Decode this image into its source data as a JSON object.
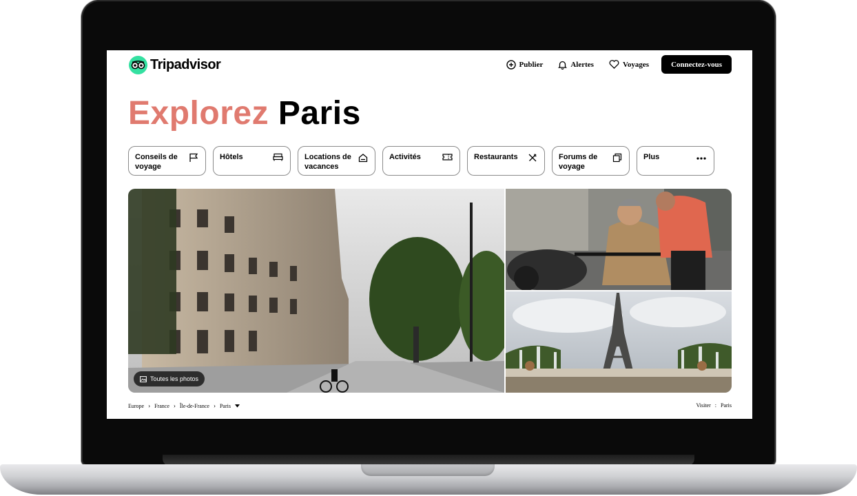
{
  "brand": {
    "name": "Tripadvisor",
    "accent": "#34e0a1",
    "title_accent_color": "#e07a6f"
  },
  "nav": {
    "publish": "Publier",
    "alerts": "Alertes",
    "trips": "Voyages",
    "signin": "Connectez-vous"
  },
  "title": {
    "accent": "Explorez",
    "city": "Paris"
  },
  "categories": [
    {
      "label": "Conseils de voyage",
      "icon": "flag-icon"
    },
    {
      "label": "Hôtels",
      "icon": "bed-icon"
    },
    {
      "label": "Locations de vacances",
      "icon": "house-icon"
    },
    {
      "label": "Activités",
      "icon": "ticket-icon"
    },
    {
      "label": "Restaurants",
      "icon": "fork-knife-icon"
    },
    {
      "label": "Forums de voyage",
      "icon": "chat-icon"
    },
    {
      "label": "Plus",
      "icon": "more-dots-icon"
    }
  ],
  "photos": {
    "all_photos_label": "Toutes les photos"
  },
  "breadcrumb": [
    "Europe",
    "France",
    "Île-de-France",
    "Paris"
  ],
  "visit": {
    "label": "Visiter",
    "separator": ":",
    "value": "Paris"
  }
}
